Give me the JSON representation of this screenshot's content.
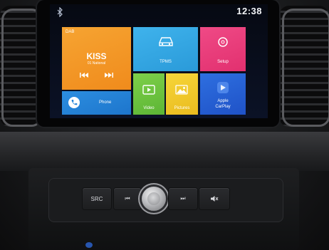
{
  "status_bar": {
    "time": "12:38",
    "bluetooth_icon": "bluetooth-icon"
  },
  "tiles": {
    "dab": {
      "tag": "DAB",
      "station": "KISS",
      "subtitle": "01 National",
      "prev_icon": "skip-back-icon",
      "next_icon": "skip-forward-icon",
      "color": "#f49a2a"
    },
    "tpms": {
      "label": "TPMS",
      "icon": "car-icon",
      "color": "#36a9e6"
    },
    "setup": {
      "label": "Setup",
      "icon": "settings-ring-icon",
      "color": "#ea3d7b"
    },
    "phone": {
      "label": "Phone",
      "icon": "phone-icon",
      "color": "#2584d8"
    },
    "video": {
      "label": "Video",
      "icon": "video-icon",
      "color": "#6cc23f"
    },
    "pictures": {
      "label": "Pictures",
      "icon": "picture-icon",
      "color": "#f0c82c"
    },
    "carplay": {
      "label_line1": "Apple",
      "label_line2": "CarPlay",
      "icon": "carplay-icon",
      "color": "#275fd6"
    }
  },
  "hardware_buttons": {
    "src": "SRC",
    "prev": "⏮",
    "next": "⏭",
    "mute": "mute-icon"
  }
}
